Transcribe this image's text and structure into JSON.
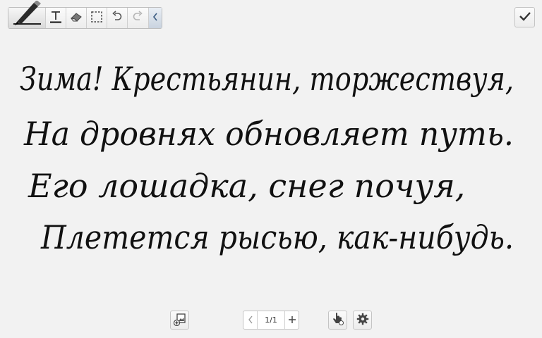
{
  "toolbar": {
    "tools": [
      {
        "name": "pen",
        "icon": "pen-icon",
        "selected": true
      },
      {
        "name": "text",
        "icon": "text-icon"
      },
      {
        "name": "eraser",
        "icon": "eraser-icon"
      },
      {
        "name": "selection",
        "icon": "selection-icon"
      },
      {
        "name": "undo",
        "icon": "undo-icon"
      },
      {
        "name": "redo",
        "icon": "redo-icon",
        "enabled": false
      },
      {
        "name": "collapse",
        "icon": "chevron-left-icon"
      }
    ]
  },
  "done": {
    "icon": "checkmark-icon"
  },
  "note": {
    "lines": [
      "Зима! Крестьянин, торжествуя,",
      "На дровнях обновляет путь.",
      "Его лошадка, снег почуя,",
      "Плетется рысью, как-нибудь."
    ],
    "ink_color": "#111111"
  },
  "bottom_bar": {
    "add_page_icon": "add-page-icon",
    "page_label": "1/1",
    "prev_icon": "chevron-left-icon",
    "next_icon": "plus-icon",
    "touch_mode_icon": "hand-pointer-icon",
    "settings_icon": "gear-icon"
  },
  "colors": {
    "background": "#f2f2f2",
    "button_border": "#c4c4c4"
  }
}
